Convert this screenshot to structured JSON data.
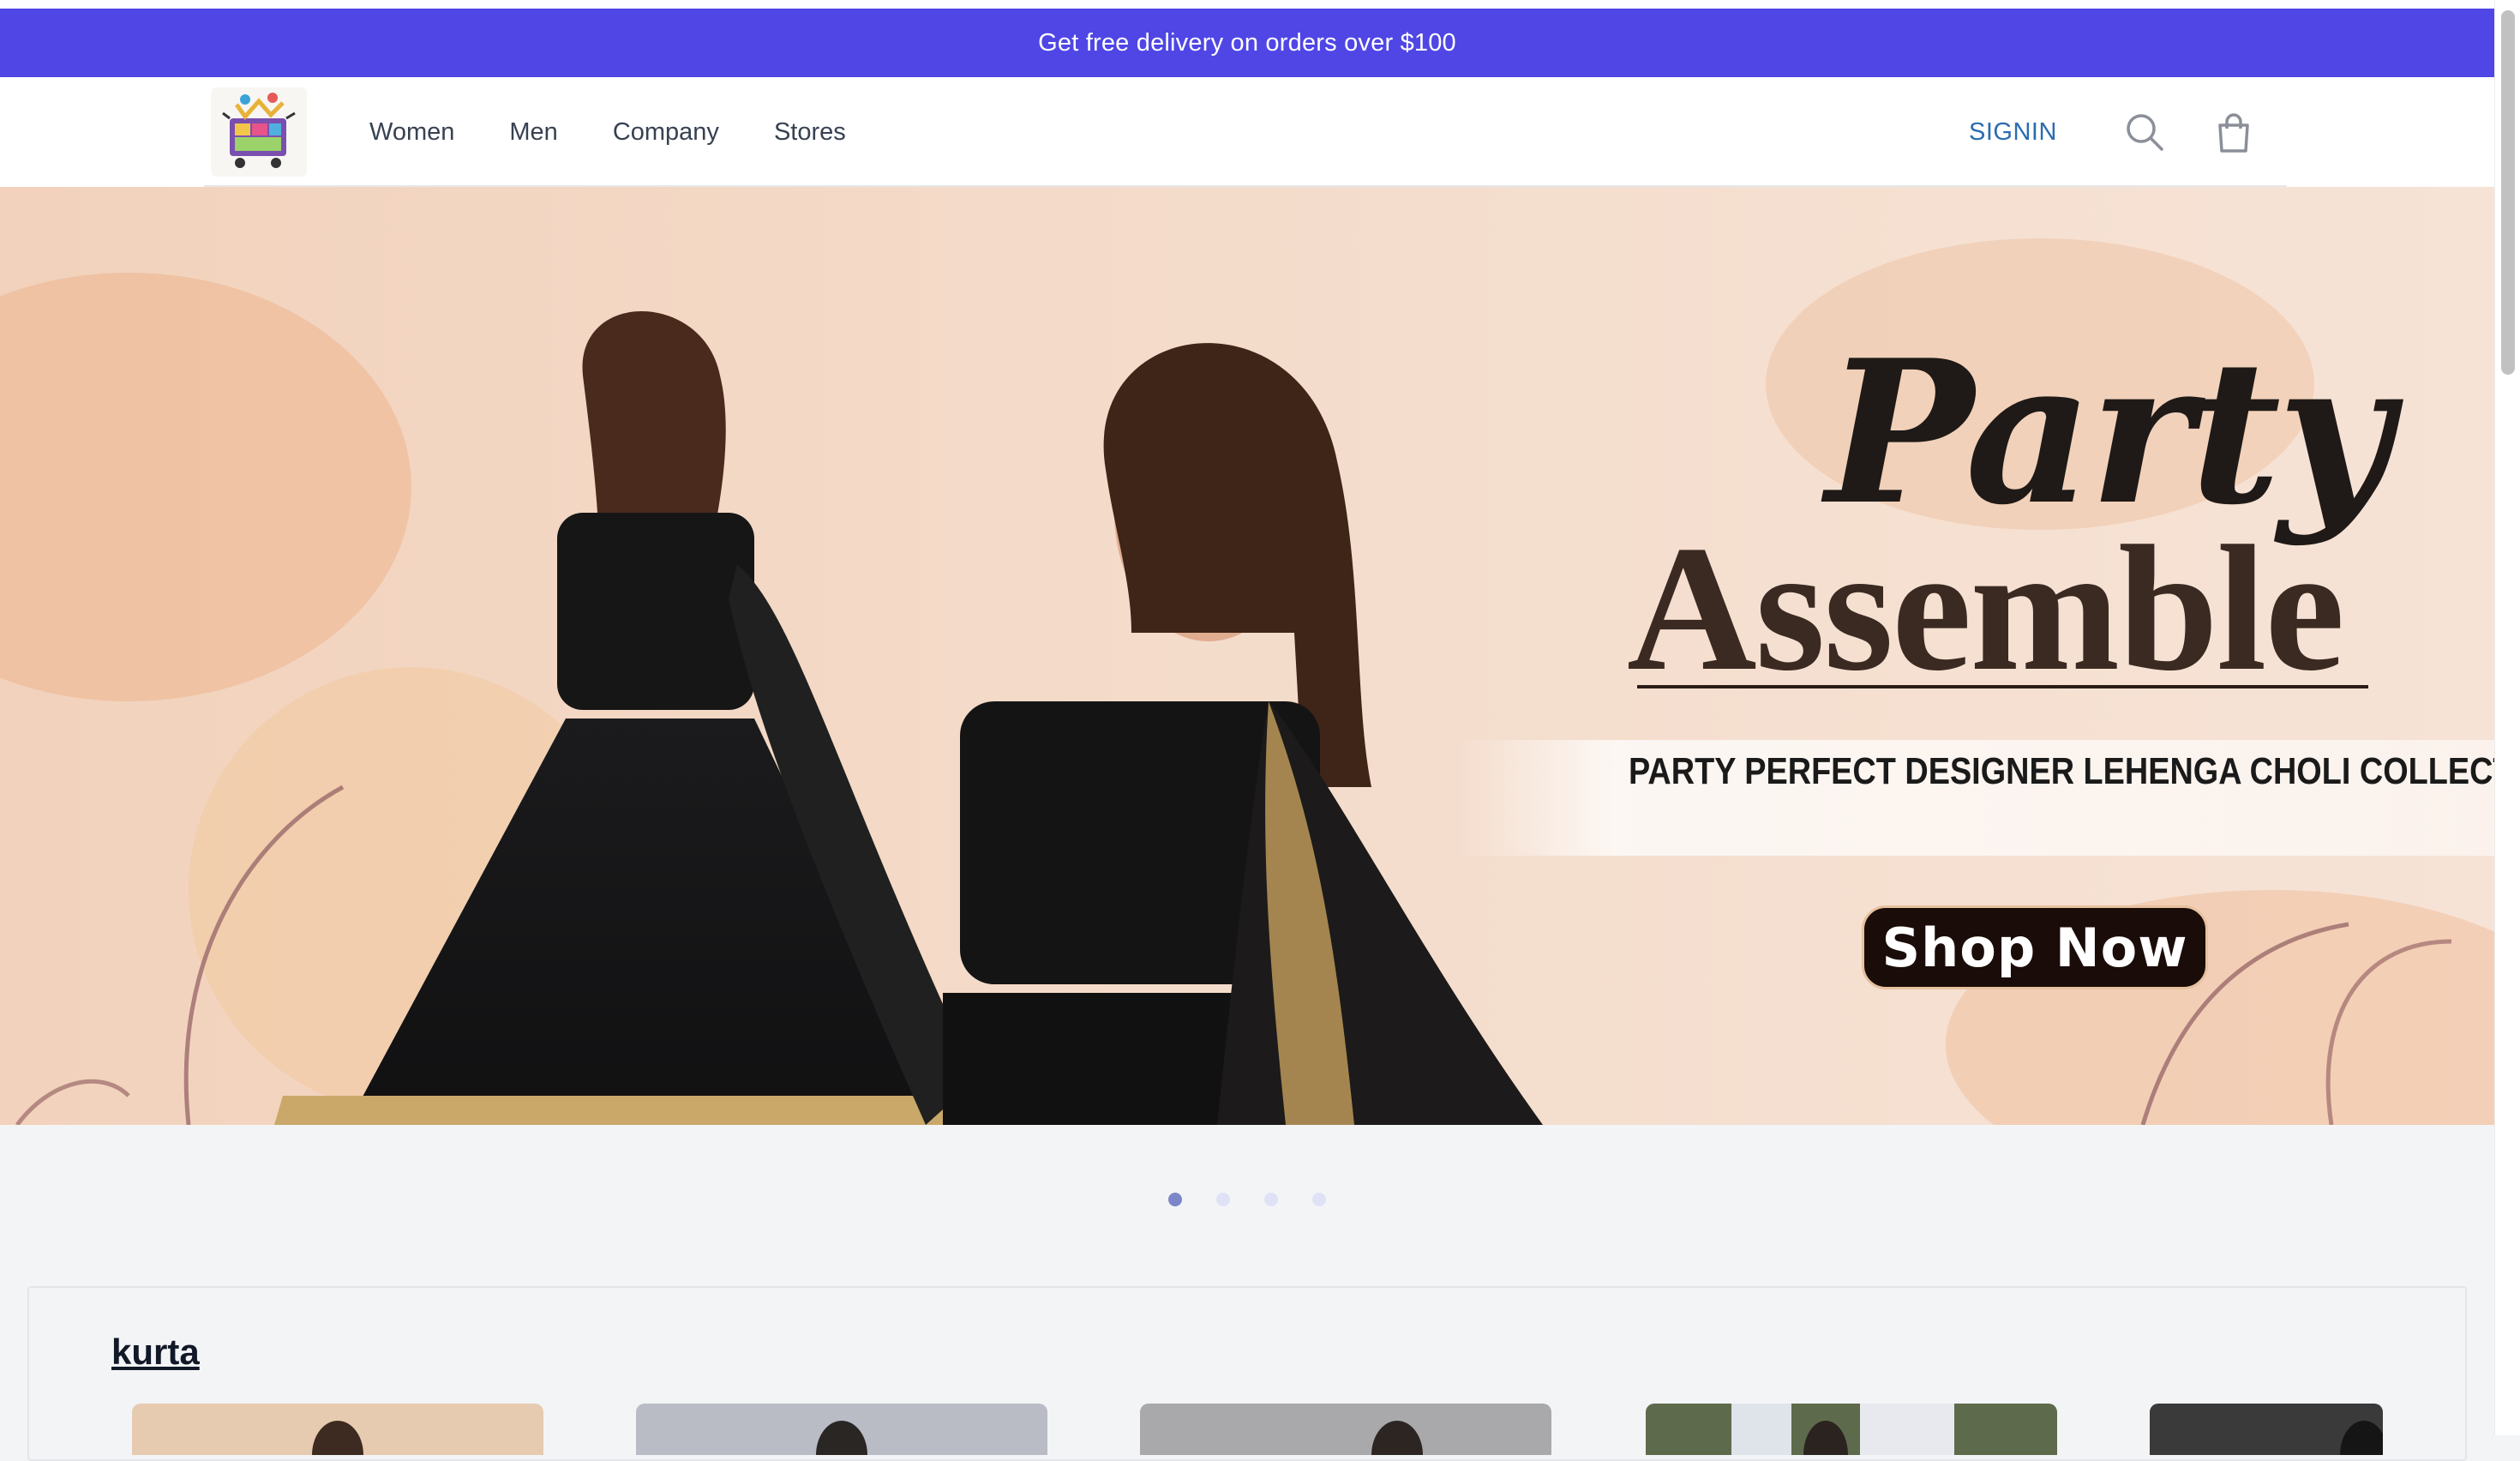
{
  "promo_banner": {
    "text": "Get free delivery on orders over $100"
  },
  "nav": {
    "links": [
      "Women",
      "Men",
      "Company",
      "Stores"
    ],
    "signin": "SIGNIN",
    "icons": {
      "search": "search-icon",
      "cart": "shopping-bag-icon",
      "logo": "shop-cart-logo"
    }
  },
  "hero": {
    "headline_script": "Party",
    "headline_serif": "Assemble",
    "subline": "PARTY PERFECT DESIGNER LEHENGA CHOLI COLLECTION.",
    "cta": "Shop Now",
    "slides_total": 4,
    "active_slide": 1
  },
  "section": {
    "title": "kurta"
  },
  "colors": {
    "promo_bg": "#4f46e5",
    "signin": "#2b6cb0",
    "hero_bg": "#f3d7c2",
    "cta_bg": "#1a0c08"
  }
}
